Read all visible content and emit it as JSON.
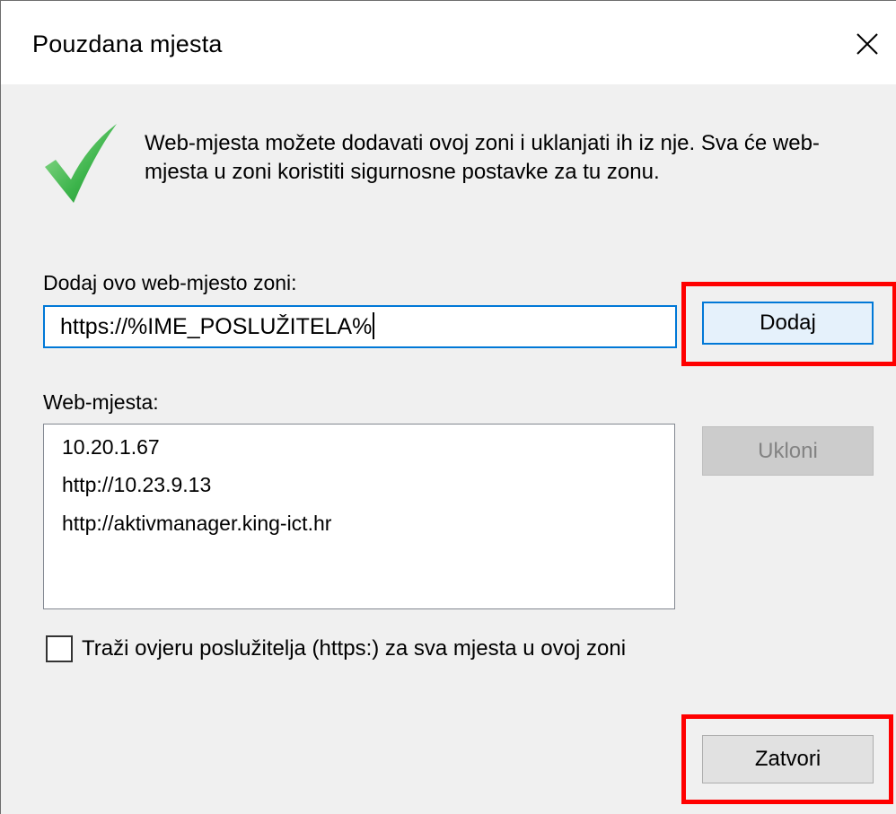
{
  "window": {
    "title": "Pouzdana mjesta",
    "close_glyph": "close-icon"
  },
  "info": {
    "icon": "checkmark-icon",
    "text": "Web-mjesta možete dodavati ovoj zoni i uklanjati ih iz nje. Sva će web-mjesta u zoni koristiti sigurnosne postavke za tu zonu."
  },
  "add_site": {
    "label": "Dodaj ovo web-mjesto zoni:",
    "value": "https://%IME_POSLUŽITELA%",
    "button": "Dodaj"
  },
  "sites": {
    "label": "Web-mjesta:",
    "items": [
      "10.20.1.67",
      "http://10.23.9.13",
      "http://aktivmanager.king-ict.hr"
    ],
    "remove_button": "Ukloni"
  },
  "verify": {
    "checked": false,
    "label": "Traži ovjeru poslužitelja (https:) za sva mjesta u ovoj zoni"
  },
  "footer": {
    "close_button": "Zatvori"
  },
  "colors": {
    "accent": "#0078d7",
    "highlight": "#ff0000",
    "dialog_bg": "#f0f0f0",
    "check_green": "#3cb44b"
  }
}
